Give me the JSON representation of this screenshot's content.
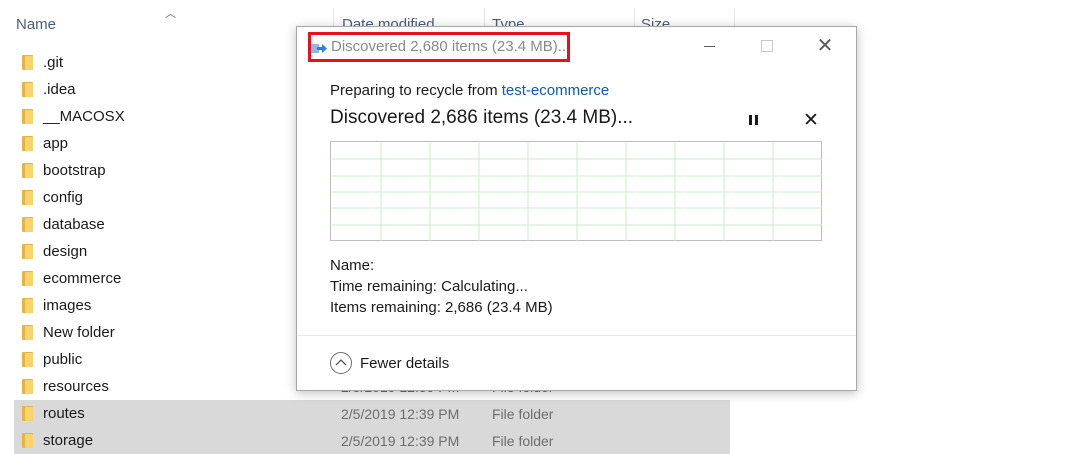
{
  "explorer": {
    "headers": {
      "name": "Name",
      "date": "Date modified",
      "type": "Type",
      "size": "Size"
    },
    "rows": [
      {
        "name": ".git",
        "date": "",
        "type": ""
      },
      {
        "name": ".idea",
        "date": "",
        "type": ""
      },
      {
        "name": "__MACOSX",
        "date": "",
        "type": ""
      },
      {
        "name": "app",
        "date": "",
        "type": ""
      },
      {
        "name": "bootstrap",
        "date": "",
        "type": ""
      },
      {
        "name": "config",
        "date": "",
        "type": ""
      },
      {
        "name": "database",
        "date": "",
        "type": ""
      },
      {
        "name": "design",
        "date": "",
        "type": ""
      },
      {
        "name": "ecommerce",
        "date": "",
        "type": ""
      },
      {
        "name": "images",
        "date": "",
        "type": ""
      },
      {
        "name": "New folder",
        "date": "",
        "type": ""
      },
      {
        "name": "public",
        "date": "",
        "type": ""
      },
      {
        "name": "resources",
        "date": "2/5/2019 12:39 PM",
        "type": "File folder"
      },
      {
        "name": "routes",
        "date": "2/5/2019 12:39 PM",
        "type": "File folder",
        "selected": true
      },
      {
        "name": "storage",
        "date": "2/5/2019 12:39 PM",
        "type": "File folder",
        "selected": true
      }
    ]
  },
  "dialog": {
    "title": "Discovered 2,680 items (23.4 MB)...",
    "preparing_prefix": "Preparing to recycle from ",
    "source_folder": "test-ecommerce",
    "headline": "Discovered 2,686 items (23.4 MB)...",
    "name_label": "Name:",
    "time_remaining": "Time remaining:  Calculating...",
    "items_remaining": "Items remaining:  2,686 (23.4 MB)",
    "fewer_details": "Fewer details",
    "icons": {
      "title": "recycle-transfer-icon",
      "pause": "pause-icon",
      "cancel": "close-icon",
      "fewer": "chevron-up-circle-icon"
    },
    "colors": {
      "highlight": "#e8101a",
      "link": "#0b5cad",
      "grid": "#c9ecc9"
    }
  }
}
